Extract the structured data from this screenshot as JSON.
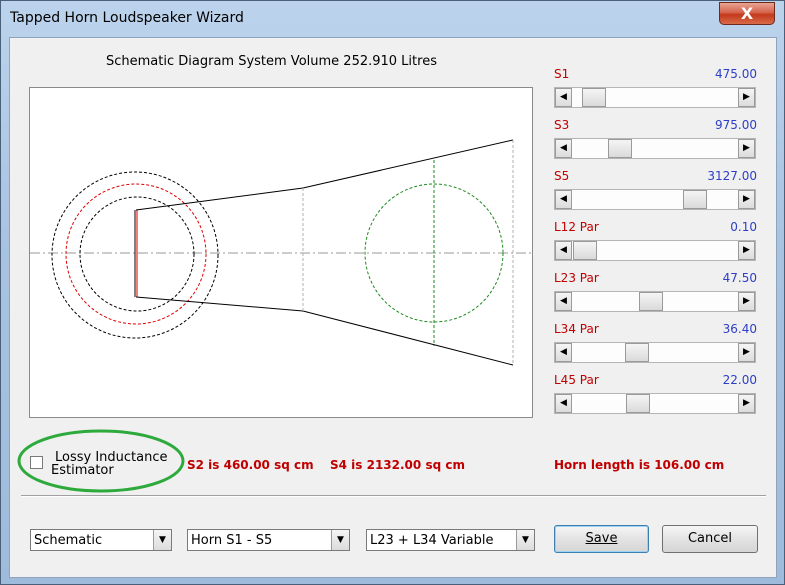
{
  "window": {
    "title": "Tapped Horn Loudspeaker Wizard",
    "close_glyph": "X"
  },
  "heading": "Schematic Diagram   System Volume 252.910 Litres",
  "params": [
    {
      "label": "S1",
      "value": "475.00",
      "fraction": 0.07
    },
    {
      "label": "S3",
      "value": "975.00",
      "fraction": 0.25
    },
    {
      "label": "S5",
      "value": "3127.00",
      "fraction": 0.78
    },
    {
      "label": "L12  Par",
      "value": "0.10",
      "fraction": 0.01
    },
    {
      "label": "L23  Par",
      "value": "47.50",
      "fraction": 0.47
    },
    {
      "label": "L34  Par",
      "value": "36.40",
      "fraction": 0.37
    },
    {
      "label": "L45  Par",
      "value": "22.00",
      "fraction": 0.38
    }
  ],
  "options": {
    "lossy_inductance_label_line1": "Lossy Inductance",
    "lossy_inductance_label_line2": "Estimator",
    "lossy_inductance_checked": false
  },
  "status": {
    "s2": "S2 is 460.00 sq cm",
    "s4": "S4 is 2132.00 sq cm",
    "horn_length": "Horn length is 106.00 cm"
  },
  "combos": [
    {
      "value": "Schematic"
    },
    {
      "value": "Horn S1 - S5"
    },
    {
      "value": "L23 + L34 Variable"
    }
  ],
  "buttons": {
    "save": "Save",
    "cancel": "Cancel"
  },
  "colors": {
    "label_red": "#c00000",
    "value_blue": "#2e3ec8",
    "highlight_green": "#2eaa3c"
  }
}
